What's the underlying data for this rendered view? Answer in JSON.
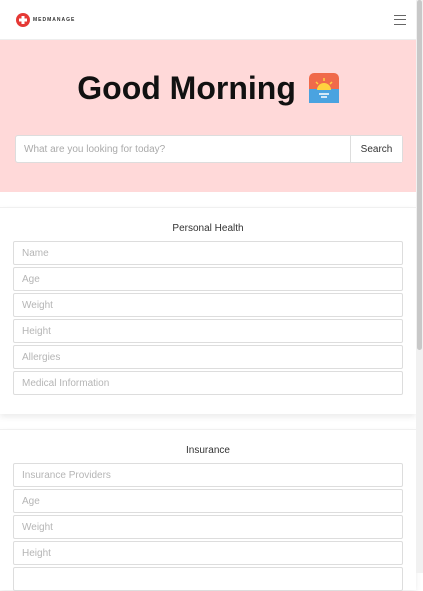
{
  "brand": {
    "name": "MEDMANAGE"
  },
  "hero": {
    "greeting": "Good Morning",
    "search": {
      "placeholder": "What are you looking for today?",
      "button_label": "Search"
    }
  },
  "personal_health": {
    "title": "Personal Health",
    "fields": [
      "Name",
      "Age",
      "Weight",
      "Height",
      "Allergies",
      "Medical Information"
    ]
  },
  "insurance": {
    "title": "Insurance",
    "fields": [
      "Insurance Providers",
      "Age",
      "Weight",
      "Height",
      ""
    ]
  },
  "colors": {
    "hero_bg": "#ffd9d9",
    "logo_red": "#e53935"
  }
}
